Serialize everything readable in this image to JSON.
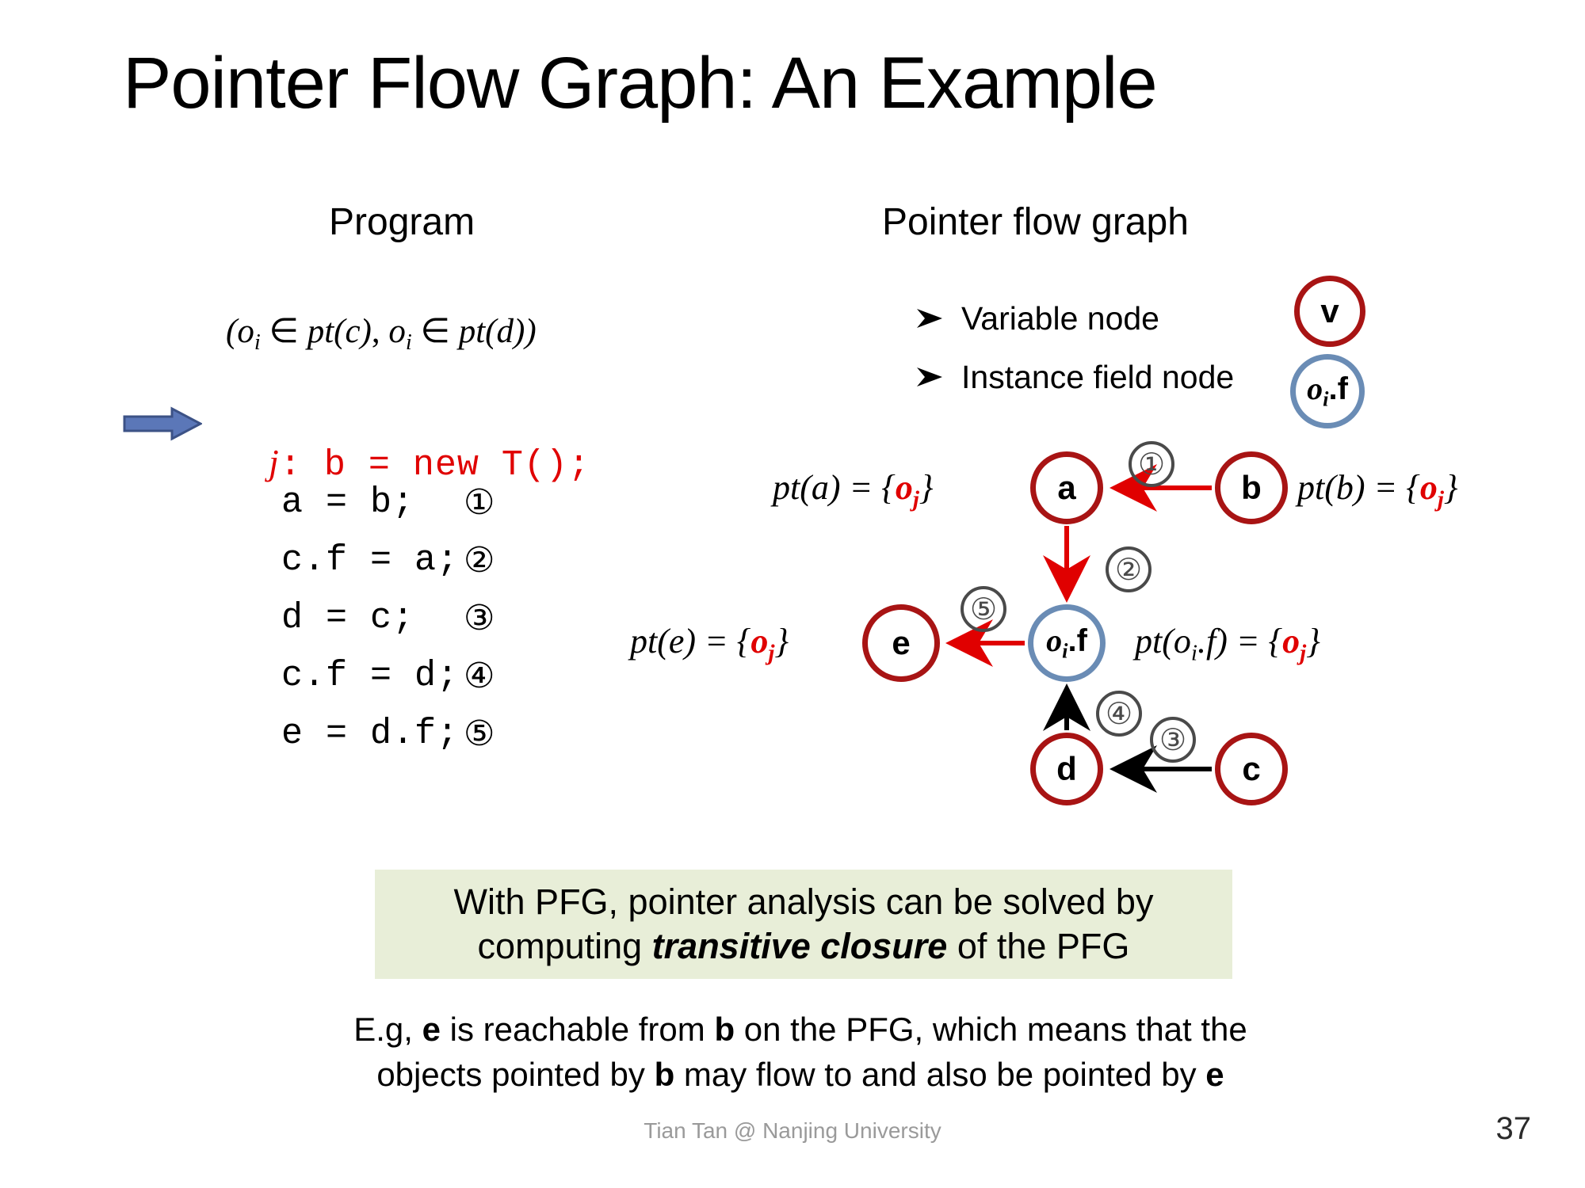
{
  "slide": {
    "title": "Pointer Flow Graph: An Example",
    "page_number": "37",
    "credit": "Tian Tan @ Nanjing University"
  },
  "program": {
    "heading": "Program",
    "precondition": {
      "prefix": "(",
      "o1": "o",
      "o1_sub": "i",
      "in1": " ∈ ",
      "pt1": "pt(c)",
      "sep": ", ",
      "o2": "o",
      "o2_sub": "i",
      "in2": " ∈ ",
      "pt2": "pt(d)",
      "suffix": ")"
    },
    "highlight_line": {
      "label": "j",
      "colon": ": ",
      "code": "b = new T();",
      "color": "#e00000"
    },
    "arrow_marker_color": "#5b77b8",
    "lines": [
      {
        "stmt": "a = b;",
        "num": "①"
      },
      {
        "stmt": "c.f = a;",
        "num": "②"
      },
      {
        "stmt": "d = c;",
        "num": "③"
      },
      {
        "stmt": "c.f = d;",
        "num": "④"
      },
      {
        "stmt": "e = d.f;",
        "num": "⑤"
      }
    ]
  },
  "pfg": {
    "heading": "Pointer flow graph",
    "legend": [
      {
        "label": "Variable node",
        "node_text": "v",
        "node_kind": "variable",
        "color": "#a81414"
      },
      {
        "label": "Instance field node",
        "node_text": "oi.f",
        "node_kind": "instance-field",
        "color": "#6a8cb5"
      }
    ],
    "legend_nodes": {
      "variable": {
        "text": "v"
      },
      "instance_field": {
        "o": "o",
        "sub": "i",
        "dot_f": ".f"
      }
    },
    "nodes": [
      {
        "id": "a",
        "text": "a",
        "kind": "variable"
      },
      {
        "id": "b",
        "text": "b",
        "kind": "variable"
      },
      {
        "id": "e",
        "text": "e",
        "kind": "variable"
      },
      {
        "id": "d",
        "text": "d",
        "kind": "variable"
      },
      {
        "id": "c",
        "text": "c",
        "kind": "variable"
      },
      {
        "id": "oif",
        "o": "o",
        "sub": "i",
        "dot_f": ".f",
        "kind": "instance-field"
      }
    ],
    "edges": [
      {
        "num": "①",
        "from": "b",
        "to": "a",
        "color": "#e00000"
      },
      {
        "num": "②",
        "from": "a",
        "to": "oif",
        "color": "#e00000"
      },
      {
        "num": "③",
        "from": "c",
        "to": "d",
        "color": "#000000"
      },
      {
        "num": "④",
        "from": "d",
        "to": "oif",
        "color": "#000000"
      },
      {
        "num": "⑤",
        "from": "oif",
        "to": "e",
        "color": "#e00000"
      }
    ],
    "pt_labels": {
      "a": {
        "lhs": "pt(a) = {",
        "val": "o",
        "val_sub": "j",
        "rhs": "}"
      },
      "b": {
        "lhs": "pt(b) = {",
        "val": "o",
        "val_sub": "j",
        "rhs": "}"
      },
      "e": {
        "lhs": "pt(e) = {",
        "val": "o",
        "val_sub": "j",
        "rhs": "}"
      },
      "oif": {
        "lhs_o": "pt(o",
        "lhs_sub": "i",
        "lhs_rest": ".f) = {",
        "val": "o",
        "val_sub": "j",
        "rhs": "}"
      }
    }
  },
  "callout": {
    "background": "#e8eed8",
    "line1": "With PFG, pointer analysis can be solved by",
    "line2_pre": "computing ",
    "line2_em": "transitive closure",
    "line2_post": " of the PFG"
  },
  "explanation": {
    "p1_a": "E.g, ",
    "p1_b1": "e",
    "p1_c": " is reachable from ",
    "p1_b2": "b",
    "p1_d": " on the PFG, which means that the",
    "p2_a": "objects pointed by ",
    "p2_b1": "b",
    "p2_c": " may flow to and also be pointed by ",
    "p2_b2": "e"
  }
}
